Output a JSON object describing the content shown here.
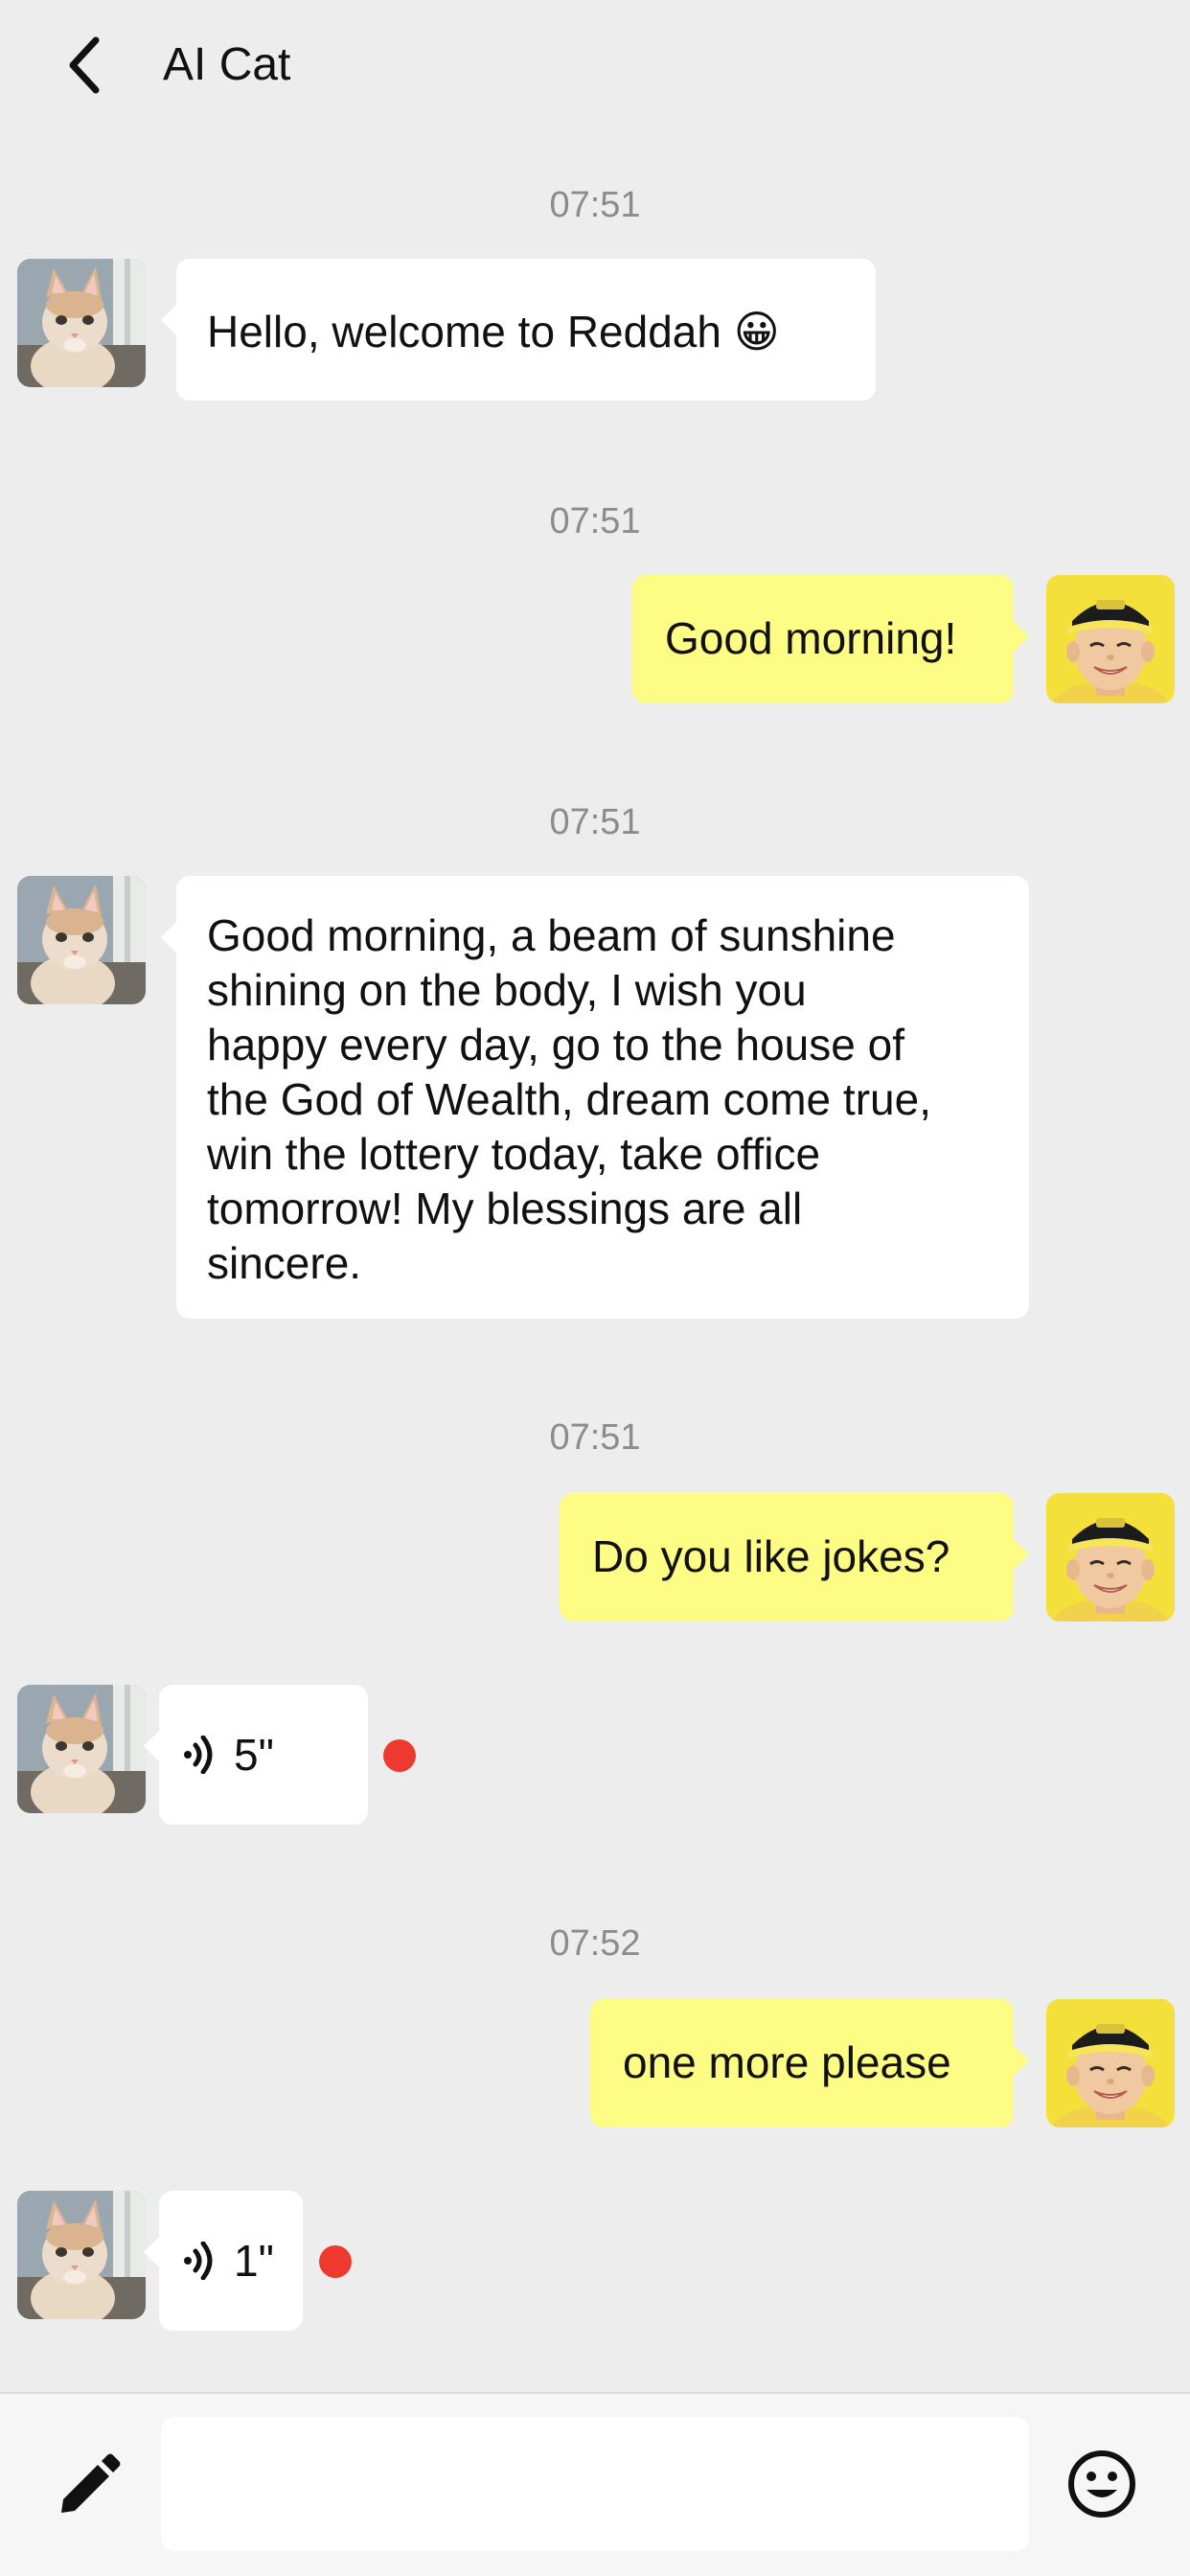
{
  "header": {
    "title": "AI Cat",
    "back_icon": "chevron-left-icon"
  },
  "messages": [
    {
      "timestamp": "07:51",
      "sender": "bot",
      "avatar": "cat-avatar",
      "text": "Hello, welcome to Reddah 😀"
    },
    {
      "timestamp": "07:51",
      "sender": "user",
      "avatar": "boy-avatar",
      "text": "Good morning!"
    },
    {
      "timestamp": "07:51",
      "sender": "bot",
      "avatar": "cat-avatar",
      "lines": [
        "Good morning, a beam of sunshine",
        "shining on the body, I wish you",
        "happy every day, go to the house of",
        "the God of Wealth, dream come true,",
        "win the lottery today, take office",
        "tomorrow! My blessings are all",
        "sincere."
      ]
    },
    {
      "timestamp": "07:51",
      "sender": "user",
      "avatar": "boy-avatar",
      "text": "Do you like jokes?"
    },
    {
      "sender": "bot",
      "avatar": "cat-avatar",
      "voice_duration": "5\"",
      "unread": true
    },
    {
      "timestamp": "07:52",
      "sender": "user",
      "avatar": "boy-avatar",
      "text": "one more please"
    },
    {
      "sender": "bot",
      "avatar": "cat-avatar",
      "voice_duration": "1\"",
      "unread": true
    }
  ],
  "footer": {
    "input_value": "",
    "input_placeholder": "",
    "left_icon": "pencil-icon",
    "right_icon": "emoji-icon"
  },
  "colors": {
    "background": "#ededed",
    "bot_bubble": "#ffffff",
    "user_bubble": "#fdfd86",
    "unread_dot": "#ee3a2e",
    "timestamp": "#8c8c8c"
  }
}
